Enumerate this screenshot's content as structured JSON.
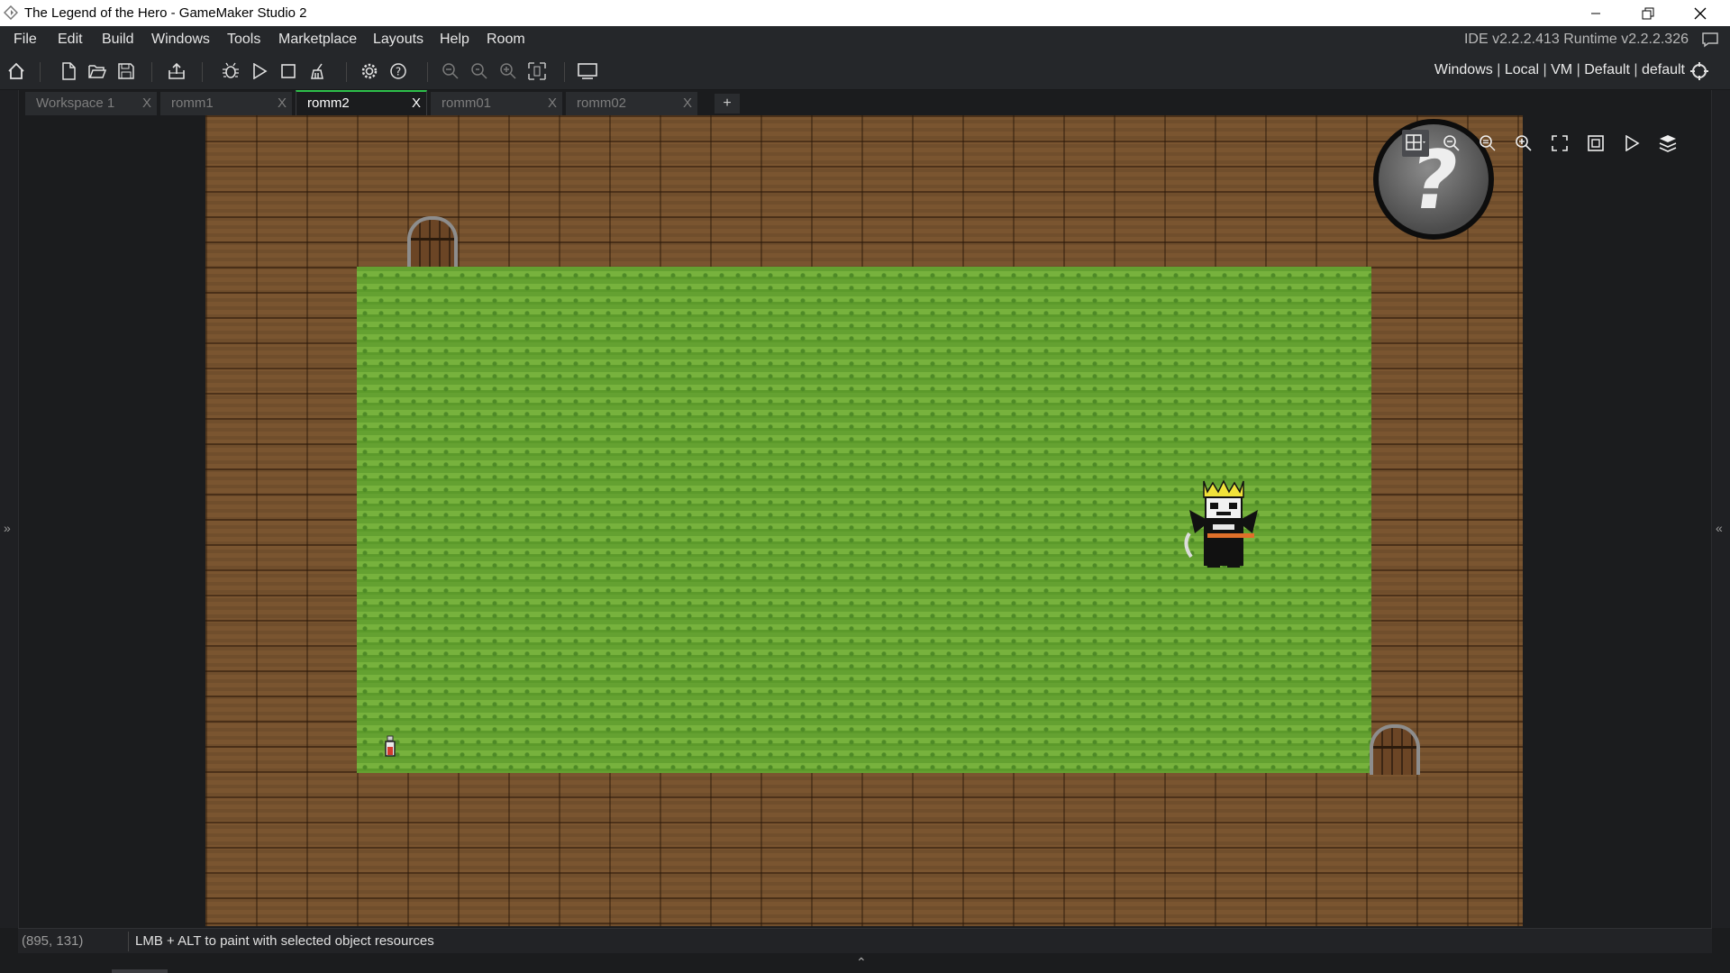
{
  "window": {
    "title": "The Legend of the Hero - GameMaker Studio 2",
    "minimize": "–",
    "maximize": "❐",
    "close": "✕"
  },
  "menu": {
    "items": [
      "File",
      "Edit",
      "Build",
      "Windows",
      "Tools",
      "Marketplace",
      "Layouts",
      "Help",
      "Room"
    ],
    "version": "IDE v2.2.2.413  Runtime v2.2.2.326"
  },
  "toolbar": {
    "targets": [
      "Windows",
      "Local",
      "VM",
      "Default",
      "default"
    ],
    "separator": "|"
  },
  "tabs": [
    {
      "label": "Workspace 1",
      "active": false
    },
    {
      "label": "romm1",
      "active": false
    },
    {
      "label": "romm2",
      "active": true
    },
    {
      "label": "romm01",
      "active": false
    },
    {
      "label": "romm02",
      "active": false
    }
  ],
  "tab_close": "X",
  "tab_add": "+",
  "room": {
    "help_glyph": "?"
  },
  "status": {
    "coords": "(895, 131)",
    "hint": "LMB + ALT to paint with selected object resources"
  },
  "gutters": {
    "left": "»",
    "right": "«"
  },
  "bottom_arrow": "⌃",
  "colors": {
    "accent": "#2dbf4a",
    "dirt": "#7a5530",
    "grass": "#6aa534"
  }
}
